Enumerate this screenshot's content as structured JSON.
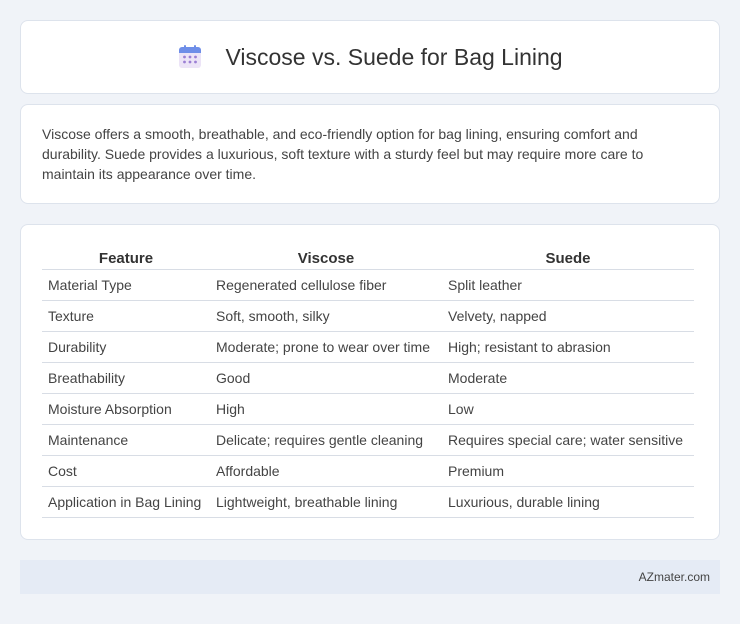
{
  "header": {
    "title": "Viscose vs. Suede for Bag Lining",
    "icon": "calendar-icon"
  },
  "summary": {
    "text": "Viscose offers a smooth, breathable, and eco-friendly option for bag lining, ensuring comfort and durability. Suede provides a luxurious, soft texture with a sturdy feel but may require more care to maintain its appearance over time."
  },
  "table": {
    "headers": [
      "Feature",
      "Viscose",
      "Suede"
    ],
    "rows": [
      [
        "Material Type",
        "Regenerated cellulose fiber",
        "Split leather"
      ],
      [
        "Texture",
        "Soft, smooth, silky",
        "Velvety, napped"
      ],
      [
        "Durability",
        "Moderate; prone to wear over time",
        "High; resistant to abrasion"
      ],
      [
        "Breathability",
        "Good",
        "Moderate"
      ],
      [
        "Moisture Absorption",
        "High",
        "Low"
      ],
      [
        "Maintenance",
        "Delicate; requires gentle cleaning",
        "Requires special care; water sensitive"
      ],
      [
        "Cost",
        "Affordable",
        "Premium"
      ],
      [
        "Application in Bag Lining",
        "Lightweight, breathable lining",
        "Luxurious, durable lining"
      ]
    ]
  },
  "footer": {
    "brand": "AZmater.com"
  },
  "colors": {
    "background": "#f0f3f8",
    "card": "#ffffff",
    "footer": "#e5ebf5",
    "icon_top": "#6e8ee8",
    "icon_body": "#ece4f7",
    "icon_dots": "#9b7fd4"
  }
}
